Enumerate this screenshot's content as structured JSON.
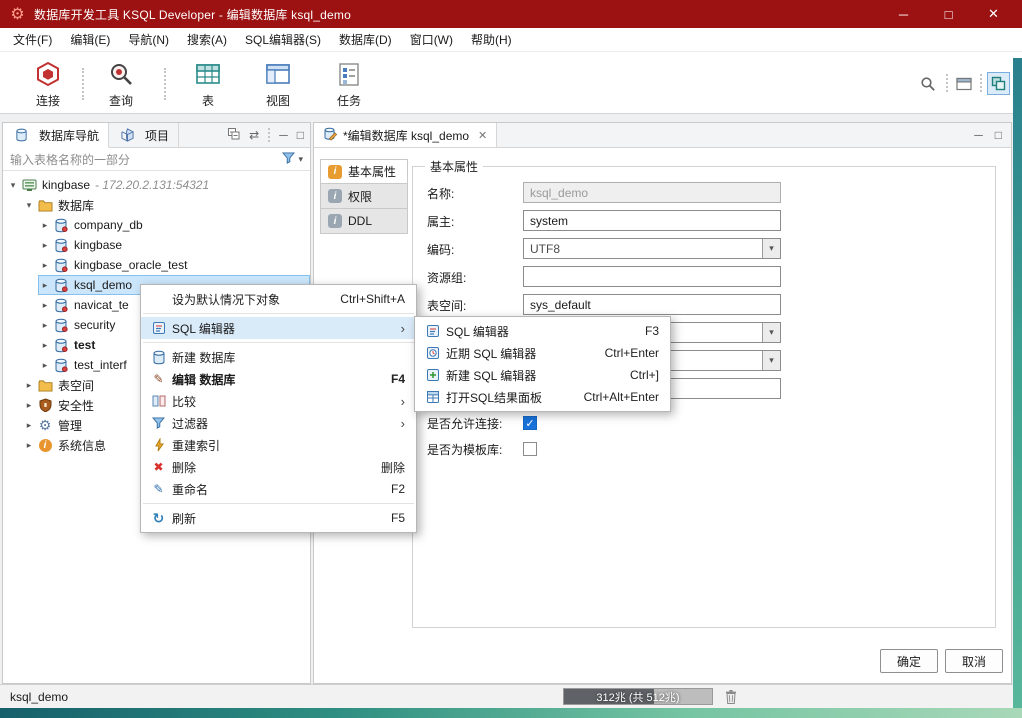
{
  "window": {
    "title": "数据库开发工具 KSQL Developer - 编辑数据库 ksql_demo"
  },
  "icons": {
    "close": "✕",
    "minimize": "─",
    "maximize": "□",
    "chevron_down": "▾",
    "chevron_right": "▸",
    "submenu_arrow": "›",
    "dropdown": "▾",
    "check": "✓",
    "refresh": "↻",
    "delete_x": "✖",
    "pencil": "✎",
    "gear": "⚙",
    "info": "i",
    "link_arrows": "⇄",
    "app_gear": "⚙"
  },
  "menu_bar": {
    "items": [
      "文件(F)",
      "编辑(E)",
      "导航(N)",
      "搜索(A)",
      "SQL编辑器(S)",
      "数据库(D)",
      "窗口(W)",
      "帮助(H)"
    ]
  },
  "toolbar": {
    "items": [
      {
        "label": "连接"
      },
      {
        "label": "查询"
      },
      {
        "label": "表"
      },
      {
        "label": "视图"
      },
      {
        "label": "任务"
      }
    ]
  },
  "navigator": {
    "tabs": [
      {
        "label": "数据库导航"
      },
      {
        "label": "项目"
      }
    ],
    "filter_text": "输入表格名称的一部分",
    "tree": [
      {
        "label": "kingbase",
        "suffix": "- 172.20.2.131:54321",
        "level": 0,
        "expanded": true,
        "icon": "server"
      },
      {
        "label": "数据库",
        "level": 1,
        "expanded": true,
        "icon": "folder"
      },
      {
        "label": "company_db",
        "level": 2,
        "icon": "database"
      },
      {
        "label": "kingbase",
        "level": 2,
        "icon": "database"
      },
      {
        "label": "kingbase_oracle_test",
        "level": 2,
        "icon": "database"
      },
      {
        "label": "ksql_demo",
        "level": 2,
        "icon": "database",
        "selected": true
      },
      {
        "label": "navicat_te",
        "level": 2,
        "icon": "database"
      },
      {
        "label": "security",
        "level": 2,
        "icon": "database"
      },
      {
        "label": "test",
        "level": 2,
        "icon": "database",
        "bold": true
      },
      {
        "label": "test_interf",
        "level": 2,
        "icon": "database"
      },
      {
        "label": "表空间",
        "level": 1,
        "icon": "folder"
      },
      {
        "label": "安全性",
        "level": 1,
        "icon": "security"
      },
      {
        "label": "管理",
        "level": 1,
        "icon": "gear"
      },
      {
        "label": "系统信息",
        "level": 1,
        "icon": "info"
      }
    ]
  },
  "context_menu": {
    "items": [
      {
        "label": "设为默认情况下对象",
        "shortcut": "Ctrl+Shift+A"
      },
      {
        "label": "SQL 编辑器",
        "submenu": true,
        "highlighted": true
      },
      {
        "label": "新建 数据库"
      },
      {
        "label": "编辑 数据库",
        "shortcut": "F4"
      },
      {
        "label": "比较",
        "submenu": true
      },
      {
        "label": "过滤器",
        "submenu": true
      },
      {
        "label": "重建索引"
      },
      {
        "label": "删除",
        "shortcut": "删除"
      },
      {
        "label": "重命名",
        "shortcut": "F2"
      },
      {
        "label": "刷新",
        "shortcut": "F5"
      }
    ]
  },
  "submenu": {
    "items": [
      {
        "label": "SQL 编辑器",
        "shortcut": "F3"
      },
      {
        "label": "近期 SQL 编辑器",
        "shortcut": "Ctrl+Enter"
      },
      {
        "label": "新建 SQL 编辑器",
        "shortcut": "Ctrl+]"
      },
      {
        "label": "打开SQL结果面板",
        "shortcut": "Ctrl+Alt+Enter"
      }
    ]
  },
  "editor": {
    "tab_label": "*编辑数据库 ksql_demo",
    "side_tabs": [
      {
        "label": "基本属性"
      },
      {
        "label": "权限"
      },
      {
        "label": "DDL"
      }
    ],
    "group_title": "基本属性",
    "fields": [
      {
        "label": "名称:",
        "value": "ksql_demo",
        "type": "text",
        "disabled": true
      },
      {
        "label": "属主:",
        "value": "system",
        "type": "text"
      },
      {
        "label": "编码:",
        "value": "UTF8",
        "type": "select"
      },
      {
        "label": "资源组:",
        "value": "",
        "type": "text"
      },
      {
        "label": "表空间:",
        "value": "sys_default",
        "type": "text"
      },
      {
        "label": "",
        "value": "",
        "type": "select"
      },
      {
        "label": "",
        "value": "",
        "type": "select"
      },
      {
        "label": "",
        "value": "",
        "type": "text"
      }
    ],
    "checkboxes": [
      {
        "label": "是否允许连接:",
        "checked": true
      },
      {
        "label": "是否为模板库:",
        "checked": false
      }
    ],
    "buttons": {
      "ok": "确定",
      "cancel": "取消"
    }
  },
  "status_bar": {
    "left_text": "ksql_demo",
    "memory_text": "312兆 (共 512兆)"
  }
}
